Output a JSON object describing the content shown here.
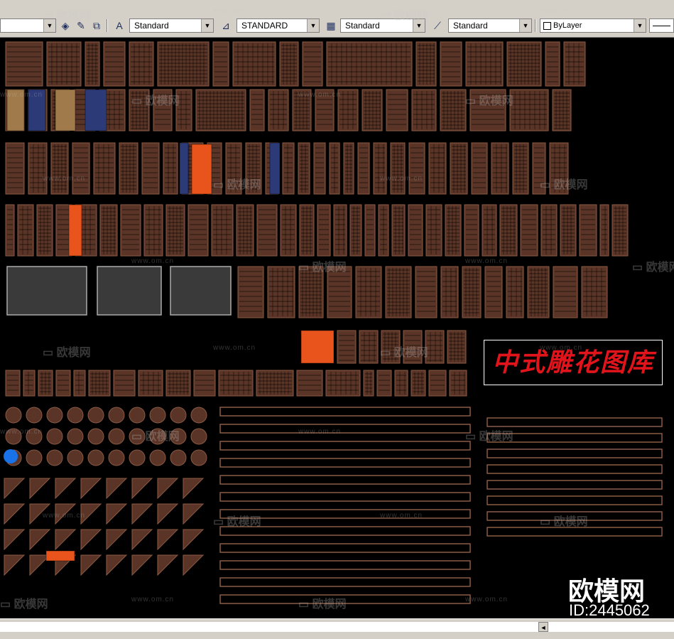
{
  "toolbar": {
    "text_style": "Standard",
    "dim_style": "STANDARD",
    "table_style": "Standard",
    "multileader_style": "Standard",
    "layer_color": "ByLayer"
  },
  "watermarks": {
    "brand": "欧模网",
    "url": "www.om.cn"
  },
  "library_title": "中式雕花图库",
  "brand_logo": "欧模网",
  "brand_id": "ID:2445062",
  "colors": {
    "carving_brown": "#5a3426",
    "carving_line": "#8a5a44",
    "accent_orange": "#e8541c",
    "accent_blue": "#2c3a78",
    "accent_tan": "#a07a4a",
    "title_red": "#e1141c"
  }
}
